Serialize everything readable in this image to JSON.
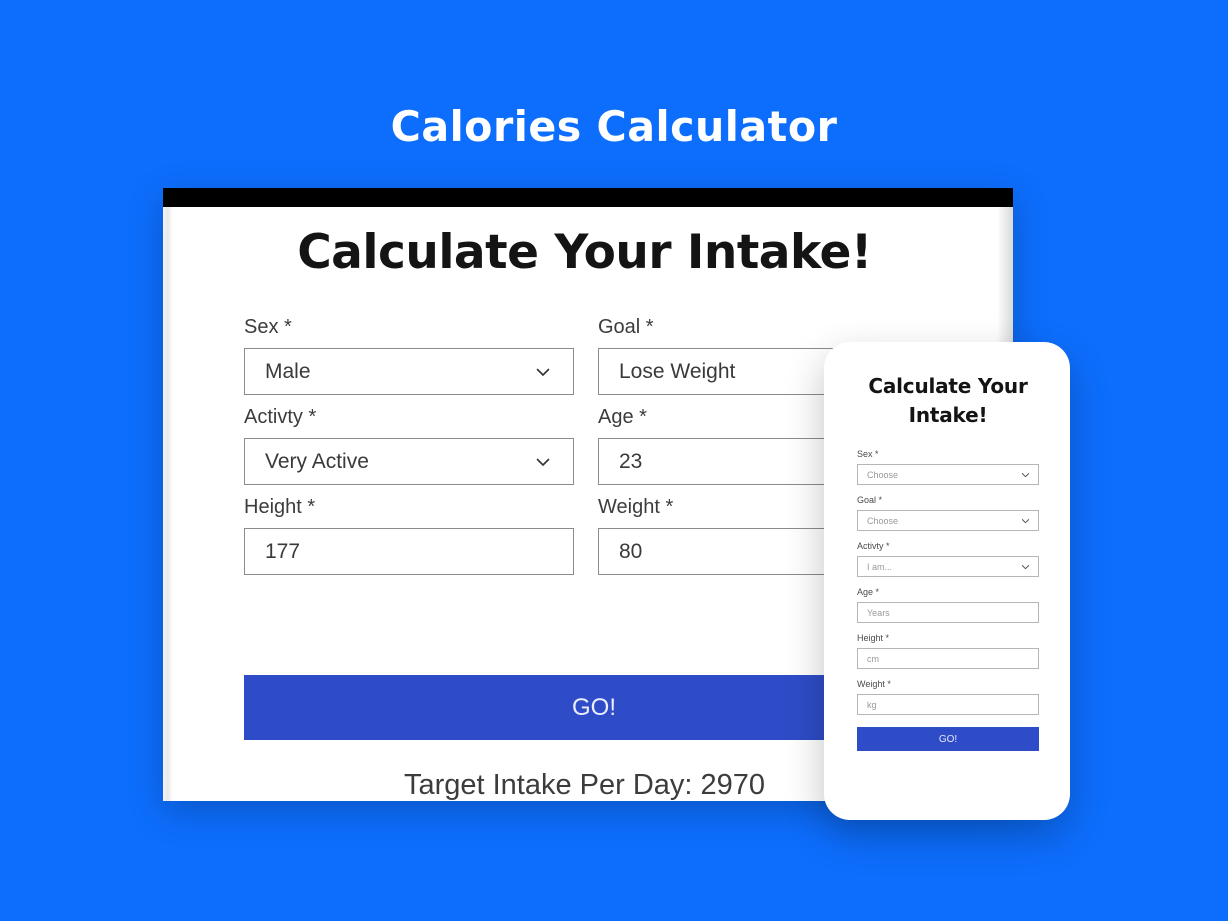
{
  "page": {
    "title": "Calories Calculator",
    "background_color": "#0d6efd",
    "accent_color": "#2f4cc8"
  },
  "desktop": {
    "heading": "Calculate Your Intake!",
    "fields": [
      {
        "label": "Sex *",
        "value": "Male",
        "type": "select",
        "icon": "chevron-down-icon"
      },
      {
        "label": "Goal *",
        "value": "Lose Weight",
        "type": "select",
        "icon": "chevron-down-icon"
      },
      {
        "label": "Activty *",
        "value": "Very Active",
        "type": "select",
        "icon": "chevron-down-icon"
      },
      {
        "label": "Age *",
        "value": "23",
        "type": "text",
        "icon": ""
      },
      {
        "label": "Height *",
        "value": "177",
        "type": "text",
        "icon": ""
      },
      {
        "label": "Weight *",
        "value": "80",
        "type": "text",
        "icon": ""
      }
    ],
    "submit_label": "GO!",
    "result_text": "Target Intake Per Day: 2970"
  },
  "mobile": {
    "heading": "Calculate Your Intake!",
    "fields": [
      {
        "label": "Sex *",
        "placeholder": "Choose",
        "type": "select",
        "icon": "chevron-down-icon"
      },
      {
        "label": "Goal *",
        "placeholder": "Choose",
        "type": "select",
        "icon": "chevron-down-icon"
      },
      {
        "label": "Activty *",
        "placeholder": "I am...",
        "type": "select",
        "icon": "chevron-down-icon"
      },
      {
        "label": "Age *",
        "placeholder": "Years",
        "type": "text",
        "icon": ""
      },
      {
        "label": "Height *",
        "placeholder": "cm",
        "type": "text",
        "icon": ""
      },
      {
        "label": "Weight *",
        "placeholder": "kg",
        "type": "text",
        "icon": ""
      }
    ],
    "submit_label": "GO!"
  }
}
